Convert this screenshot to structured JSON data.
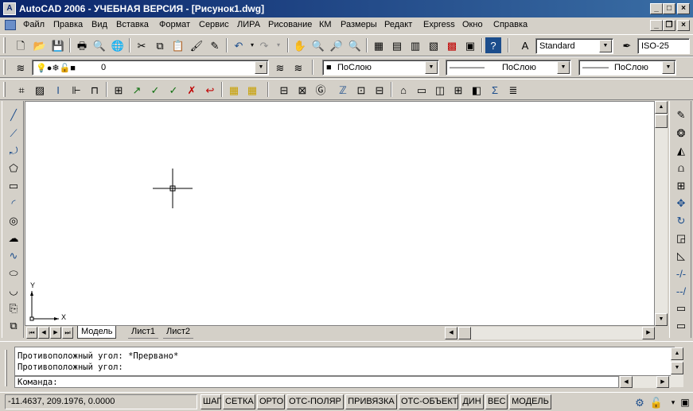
{
  "window": {
    "title": "AutoCAD 2006 - УЧЕБНАЯ ВЕРСИЯ - [Рисунок1.dwg]"
  },
  "menu": [
    "Файл",
    "Правка",
    "Вид",
    "Вставка",
    "Формат",
    "Сервис",
    "ЛИРА",
    "Рисование",
    "КМ",
    "Размеры",
    "Редакт",
    "Express",
    "Окно",
    "Справка"
  ],
  "toolbar": {
    "text_style": "Standard",
    "dim_style": "ISO-25",
    "layer": "0",
    "color": "ПоСлою",
    "linetype": "ПоСлою",
    "lineweight": "ПоСлою"
  },
  "tabs": [
    "Модель",
    "Лист1",
    "Лист2"
  ],
  "command": {
    "lines": [
      "Противоположный угол: *Прервано*",
      "Противоположный угол:"
    ],
    "prompt": "Команда:"
  },
  "status": {
    "coords": "-11.4637,  209.1976, 0.0000",
    "buttons": [
      "ШАГ",
      "СЕТКА",
      "ОРТО",
      "ОТС-ПОЛЯР",
      "ПРИВЯЗКА",
      "ОТС-ОБЪЕКТ",
      "ДИН",
      "ВЕС",
      "МОДЕЛЬ"
    ]
  },
  "ucs": {
    "x_label": "X",
    "y_label": "Y"
  },
  "colors": {
    "title_active": "#0a246a",
    "face": "#d4d0c8",
    "canvas": "#ffffff"
  }
}
